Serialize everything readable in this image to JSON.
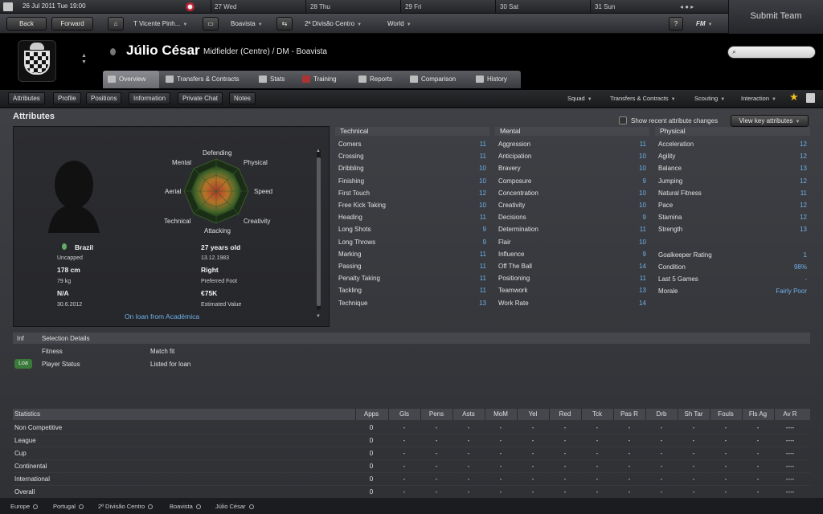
{
  "calendar": {
    "date": "26 Jul 2011 Tue 19:00",
    "days": [
      {
        "day": "27",
        "name": "Wed"
      },
      {
        "day": "28",
        "name": "Thu"
      },
      {
        "day": "29",
        "name": "Fri"
      },
      {
        "day": "30",
        "name": "Sat"
      },
      {
        "day": "31",
        "name": "Sun"
      }
    ]
  },
  "nav": {
    "back": "Back",
    "forward": "Forward",
    "manager": "T Vicente Pinh...",
    "club": "Boavista",
    "division": "2ª Divisão Centro",
    "world": "World",
    "help": "?",
    "fm": "FM",
    "submit": "Submit Team"
  },
  "player": {
    "name": "Júlio César",
    "subtitle": "Midfielder (Centre) / DM - Boavista",
    "nationality": "Brazil",
    "caps": "Uncapped",
    "height": "178 cm",
    "weight": "79 kg",
    "contract": "N/A",
    "contract_date": "30.6.2012",
    "age": "27 years old",
    "dob": "13.12.1983",
    "foot": "Right",
    "foot_label": "Preferred Foot",
    "value": "€75K",
    "value_label": "Estimated Value",
    "loan": "On loan from Académica"
  },
  "tabs": [
    "Overview",
    "Transfers & Contracts",
    "Stats",
    "Training",
    "Reports",
    "Comparison",
    "History"
  ],
  "subnav": [
    "Attributes",
    "Profile",
    "Positions",
    "Information",
    "Private Chat",
    "Notes"
  ],
  "rightmenu": [
    "Squad",
    "Transfers & Contracts",
    "Scouting",
    "Interaction"
  ],
  "attributes_title": "Attributes",
  "recent_changes": "Show recent attribute changes",
  "view_key": "View key attributes",
  "radar_labels": [
    "Defending",
    "Physical",
    "Speed",
    "Creativity",
    "Attacking",
    "Technical",
    "Aerial",
    "Mental"
  ],
  "technical": {
    "title": "Technical",
    "items": [
      [
        "Corners",
        "11"
      ],
      [
        "Crossing",
        "11"
      ],
      [
        "Dribbling",
        "10"
      ],
      [
        "Finishing",
        "10"
      ],
      [
        "First Touch",
        "12"
      ],
      [
        "Free Kick Taking",
        "10"
      ],
      [
        "Heading",
        "11"
      ],
      [
        "Long Shots",
        "9"
      ],
      [
        "Long Throws",
        "9"
      ],
      [
        "Marking",
        "11"
      ],
      [
        "Passing",
        "11"
      ],
      [
        "Penalty Taking",
        "11"
      ],
      [
        "Tackling",
        "11"
      ],
      [
        "Technique",
        "13"
      ]
    ]
  },
  "mental": {
    "title": "Mental",
    "items": [
      [
        "Aggression",
        "11"
      ],
      [
        "Anticipation",
        "10"
      ],
      [
        "Bravery",
        "10"
      ],
      [
        "Composure",
        "9"
      ],
      [
        "Concentration",
        "10"
      ],
      [
        "Creativity",
        "10"
      ],
      [
        "Decisions",
        "9"
      ],
      [
        "Determination",
        "11"
      ],
      [
        "Flair",
        "10"
      ],
      [
        "Influence",
        "9"
      ],
      [
        "Off The Ball",
        "14"
      ],
      [
        "Positioning",
        "11"
      ],
      [
        "Teamwork",
        "13"
      ],
      [
        "Work Rate",
        "14"
      ]
    ]
  },
  "physical": {
    "title": "Physical",
    "items": [
      [
        "Acceleration",
        "12"
      ],
      [
        "Agility",
        "12"
      ],
      [
        "Balance",
        "13"
      ],
      [
        "Jumping",
        "12"
      ],
      [
        "Natural Fitness",
        "11"
      ],
      [
        "Pace",
        "12"
      ],
      [
        "Stamina",
        "12"
      ],
      [
        "Strength",
        "13"
      ]
    ],
    "extra": [
      [
        "Goalkeeper Rating",
        "1"
      ],
      [
        "Condition",
        "98%"
      ],
      [
        "Last 5 Games",
        "-"
      ],
      [
        "Morale",
        "Fairly Poor"
      ]
    ]
  },
  "selection": {
    "inf": "Inf",
    "title": "Selection Details",
    "rows": [
      {
        "label": "Fitness",
        "value": "Match fit",
        "badge": ""
      },
      {
        "label": "Player Status",
        "value": "Listed for loan",
        "badge": "Loa"
      }
    ]
  },
  "stats": {
    "title": "Statistics",
    "columns": [
      "Apps",
      "Gls",
      "Pens",
      "Asts",
      "MoM",
      "Yel",
      "Red",
      "Tck",
      "Pas R",
      "Drb",
      "Sh Tar",
      "Fouls",
      "Fls Ag",
      "Av R"
    ],
    "rows": [
      [
        "Non Competitive",
        "0",
        "-",
        "-",
        "-",
        "-",
        "-",
        "-",
        "-",
        "-",
        "-",
        "-",
        "-",
        "-",
        "----"
      ],
      [
        "League",
        "0",
        "-",
        "-",
        "-",
        "-",
        "-",
        "-",
        "-",
        "-",
        "-",
        "-",
        "-",
        "-",
        "----"
      ],
      [
        "Cup",
        "0",
        "-",
        "-",
        "-",
        "-",
        "-",
        "-",
        "-",
        "-",
        "-",
        "-",
        "-",
        "-",
        "----"
      ],
      [
        "Continental",
        "0",
        "-",
        "-",
        "-",
        "-",
        "-",
        "-",
        "-",
        "-",
        "-",
        "-",
        "-",
        "-",
        "----"
      ],
      [
        "International",
        "0",
        "-",
        "-",
        "-",
        "-",
        "-",
        "-",
        "-",
        "-",
        "-",
        "-",
        "-",
        "-",
        "----"
      ],
      [
        "Overall",
        "0",
        "-",
        "-",
        "-",
        "-",
        "-",
        "-",
        "-",
        "-",
        "-",
        "-",
        "-",
        "-",
        "----"
      ]
    ]
  },
  "breadcrumb": [
    "Europe",
    "Portugal",
    "2ª Divisão Centro",
    "Boavista",
    "Júlio César"
  ],
  "colors": {
    "accent": "#6fb1e8",
    "badge": "#3a7a3a"
  }
}
